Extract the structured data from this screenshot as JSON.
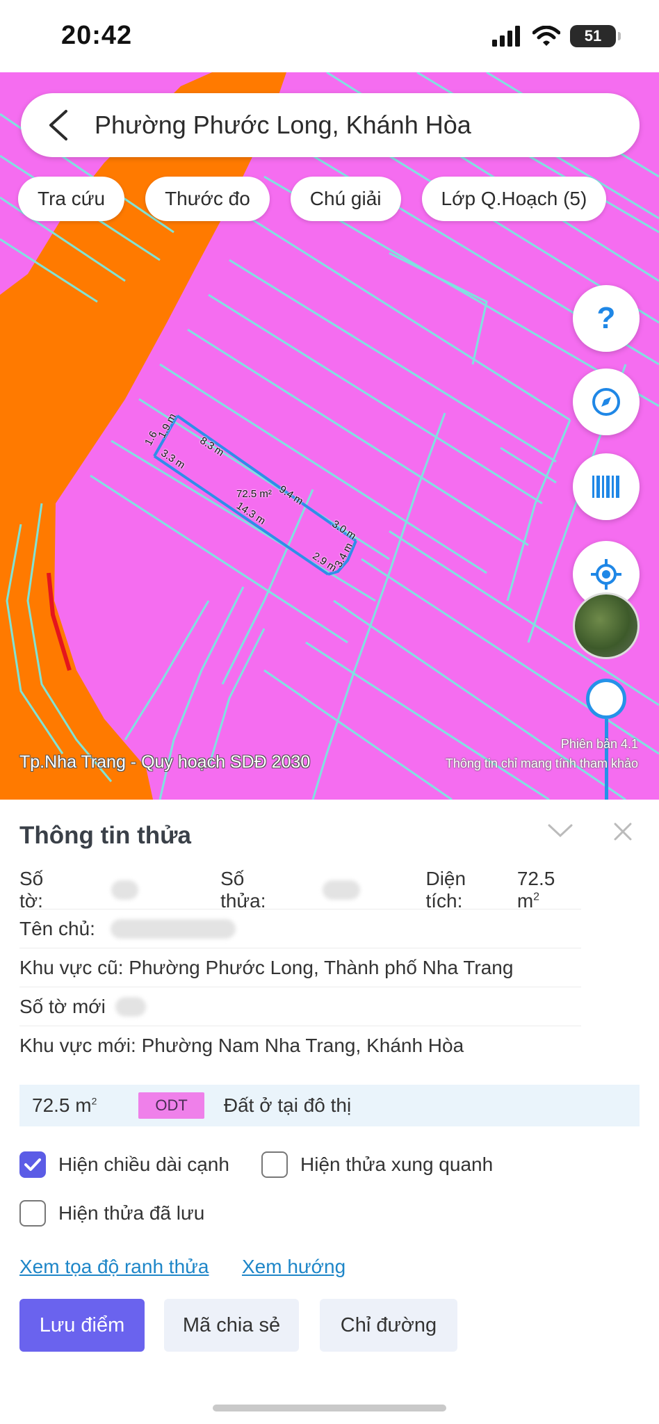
{
  "status_bar": {
    "time": "20:42",
    "battery": "51"
  },
  "search": {
    "text": "Phường Phước Long, Khánh Hòa"
  },
  "chips": [
    {
      "label": "Tra cứu"
    },
    {
      "label": "Thước đo"
    },
    {
      "label": "Chú giải"
    },
    {
      "label": "Lớp Q.Hoạch (5)"
    }
  ],
  "map": {
    "caption": "Tp.Nha Trang - Quy hoạch SDĐ 2030",
    "version": "Phiên bản 4.1",
    "disclaimer": "Thông tin chỉ mang tính tham khảo",
    "help_symbol": "?",
    "colors": {
      "land": "#f56df0",
      "road": "#ff7a00",
      "parcel_lines": "#7be8e0",
      "selected_outline": "#2f8ee8"
    },
    "measurements": {
      "left_edge_top": "1.6",
      "left_edge_a": "1.9 m",
      "left_edge_b": "3.3 m",
      "top_edge": "8.3 m",
      "top_edge_2": "9.4 m",
      "center_area": "72.5 m²",
      "bottom_edge": "14.3 m",
      "right_edge_top": "3.0 m",
      "right_edge_bottom": "3.4 m",
      "bottom_right": "2.9 m"
    }
  },
  "sheet": {
    "title": "Thông tin thửa",
    "so_to_label": "Số tờ:",
    "so_thua_label": "Số thửa:",
    "dien_tich_label": "Diện tích:",
    "dien_tich_value": "72.5 m",
    "dien_tich_unit": "2",
    "ten_chu_label": "Tên chủ:",
    "khu_vuc_cu": "Khu vực cũ: Phường Phước Long, Thành phố Nha Trang",
    "so_to_moi_label": "Số tờ mới",
    "khu_vuc_moi": "Khu vực mới: Phường Nam Nha Trang, Khánh Hòa",
    "area_value": "72.5 m",
    "area_unit": "2",
    "land_code": "ODT",
    "land_type": "Đất ở tại đô thị",
    "checkboxes": [
      {
        "label": "Hiện chiều dài cạnh",
        "checked": true
      },
      {
        "label": "Hiện thửa xung quanh",
        "checked": false
      },
      {
        "label": "Hiện thửa đã lưu",
        "checked": false
      }
    ],
    "links": {
      "coords": "Xem tọa độ ranh thửa",
      "direction": "Xem hướng"
    },
    "buttons": {
      "save": "Lưu điểm",
      "share": "Mã chia sẻ",
      "directions": "Chỉ đường"
    }
  }
}
